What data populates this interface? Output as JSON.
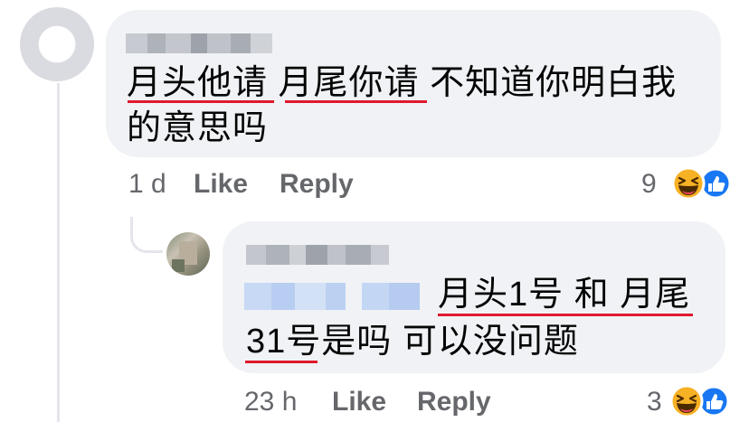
{
  "comment": {
    "text_line1": "月头他请 月尾你请 不知道你明白我",
    "text_line2": "的意思吗",
    "time": "1 d",
    "like_label": "Like",
    "reply_label": "Reply",
    "reaction_count": "9",
    "reactions": [
      "haha-icon",
      "like-icon"
    ]
  },
  "reply": {
    "text_line1": "月头1号 和 月尾",
    "text_line2": "31号是吗 可以没问题",
    "time": "23 h",
    "like_label": "Like",
    "reply_label": "Reply",
    "reaction_count": "3",
    "reactions": [
      "haha-icon",
      "like-icon"
    ]
  },
  "colors": {
    "bubble": "#f0f2f5",
    "meta_text": "#65676b",
    "underline": "#e0192d",
    "like_blue": "#1877f2",
    "haha_yellow": "#f7b125"
  }
}
